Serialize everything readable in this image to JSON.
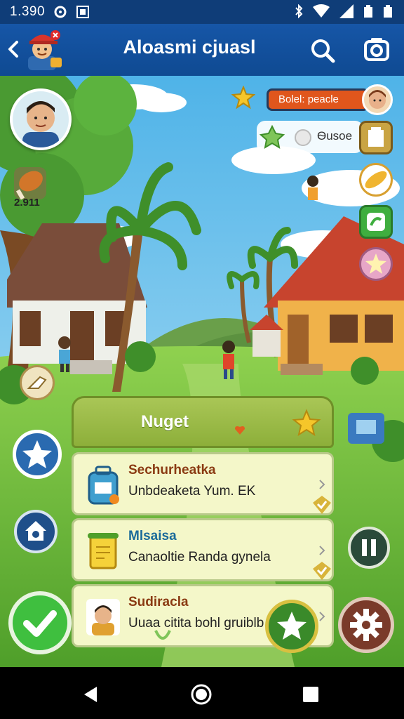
{
  "status_bar": {
    "time": "1.390"
  },
  "app_bar": {
    "title": "Alоasmi cjuasl"
  },
  "hud": {
    "food_count": "2.911",
    "badge_label": "Bolel: peacle",
    "resource_label": "Ѳusoe"
  },
  "quest_panel": {
    "title": "Nuget",
    "items": [
      {
        "name": "Sechurheatka",
        "desc": "Unbdeaketa Yum. EK",
        "name_color": "#8a3a12"
      },
      {
        "name": "Mlsaisa",
        "desc": "Canaoltie Randa gynela",
        "name_color": "#1a6a9a"
      },
      {
        "name": "Sudiracla",
        "desc": "Uuaa citita bohl gruiblb",
        "name_color": "#8a3a12"
      }
    ]
  },
  "icons": [
    "back-icon",
    "search-icon",
    "camera-icon",
    "star-icon",
    "check-icon",
    "gear-icon",
    "pause-icon",
    "home-icon",
    "shop-icon",
    "chevron-right-icon"
  ],
  "colors": {
    "app_bar": "#1656a7",
    "badge": "#e0561c",
    "quest_header": "#a9c656",
    "quest_row": "#f4f7c9",
    "check_button": "#3fbf3f"
  }
}
